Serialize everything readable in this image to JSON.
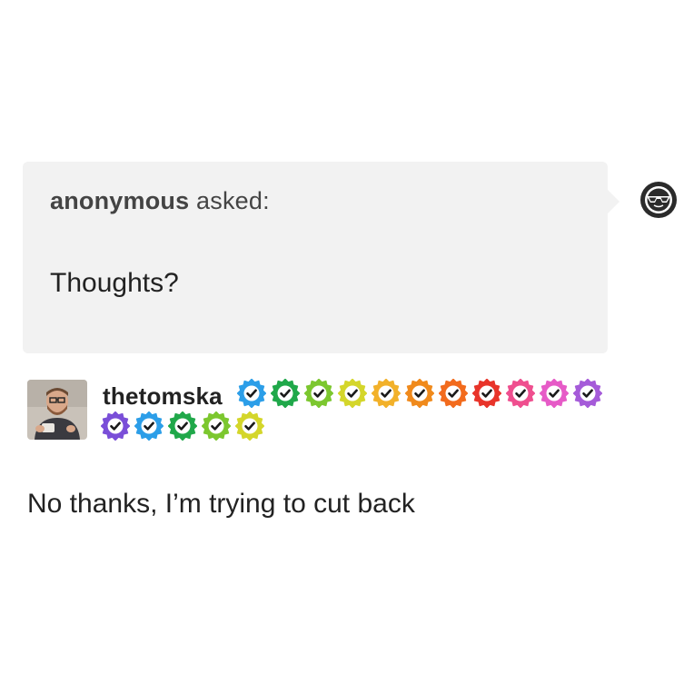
{
  "ask": {
    "asker_name": "anonymous",
    "asked_label": " asked:",
    "question": "Thoughts?"
  },
  "anon_avatar": {
    "icon": "sunglasses-face-icon",
    "bg_color": "#2b2b2b"
  },
  "answer": {
    "author": "thetomska",
    "avatar_icon": "user-photo-avatar",
    "badges_row1": [
      {
        "color": "#2c9ee8",
        "icon": "check-badge-icon"
      },
      {
        "color": "#20a84a",
        "icon": "check-badge-icon"
      },
      {
        "color": "#7cc72f",
        "icon": "check-badge-icon"
      },
      {
        "color": "#d4d62b",
        "icon": "check-badge-icon"
      },
      {
        "color": "#f2b12a",
        "icon": "check-badge-icon"
      },
      {
        "color": "#f08a1c",
        "icon": "check-badge-icon"
      },
      {
        "color": "#f26b1d",
        "icon": "check-badge-icon"
      },
      {
        "color": "#e8342a",
        "icon": "check-badge-icon"
      },
      {
        "color": "#ef4f8f",
        "icon": "check-badge-icon"
      },
      {
        "color": "#e65bc7",
        "icon": "check-badge-icon"
      },
      {
        "color": "#a55bd9",
        "icon": "check-badge-icon"
      }
    ],
    "badges_row2": [
      {
        "color": "#7a4fd8",
        "icon": "check-badge-icon"
      },
      {
        "color": "#2c9ee8",
        "icon": "check-badge-icon"
      },
      {
        "color": "#20a84a",
        "icon": "check-badge-icon"
      },
      {
        "color": "#7cc72f",
        "icon": "check-badge-icon"
      },
      {
        "color": "#d4d62b",
        "icon": "check-badge-icon"
      }
    ],
    "text": "No thanks, I’m trying to cut back"
  }
}
